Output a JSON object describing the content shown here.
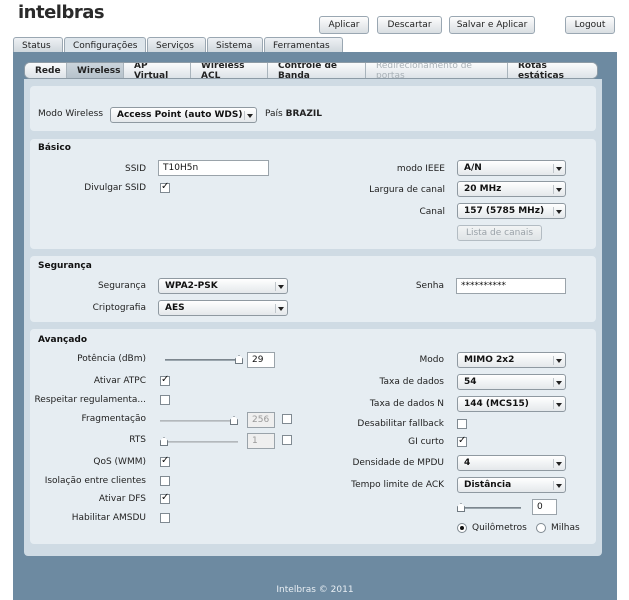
{
  "brand": "intelbras",
  "top_buttons": {
    "apply": "Aplicar",
    "discard": "Descartar",
    "save_apply": "Salvar e Aplicar",
    "logout": "Logout"
  },
  "tabs": [
    "Status",
    "Configurações",
    "Serviços",
    "Sistema",
    "Ferramentas"
  ],
  "subtabs": [
    "Rede",
    "Wireless",
    "AP Virtual",
    "Wireless ACL",
    "Controle de Banda",
    "Redirecionamento de portas",
    "Rotas estáticas"
  ],
  "mode": {
    "label": "Modo Wireless",
    "value": "Access Point (auto WDS)",
    "country_label": "País",
    "country": "BRAZIL"
  },
  "basic": {
    "title": "Básico",
    "ssid_label": "SSID",
    "ssid_value": "T10H5n",
    "broadcast_label": "Divulgar SSID",
    "ieee_label": "modo IEEE",
    "ieee_value": "A/N",
    "width_label": "Largura de canal",
    "width_value": "20 MHz",
    "channel_label": "Canal",
    "channel_value": "157 (5785 MHz)",
    "channel_list_button": "Lista de canais"
  },
  "security": {
    "title": "Segurança",
    "security_label": "Segurança",
    "security_value": "WPA2-PSK",
    "crypto_label": "Criptografia",
    "crypto_value": "AES",
    "password_label": "Senha",
    "password_value": "**********"
  },
  "advanced": {
    "title": "Avançado",
    "power_label": "Potência (dBm)",
    "power_value": "29",
    "power_level": 1.0,
    "atpc_label": "Ativar ATPC",
    "regulation_label": "Respeitar regulamenta...",
    "frag_label": "Fragmentação",
    "frag_value": "256",
    "frag_level": 1.0,
    "rts_label": "RTS",
    "rts_value": "1",
    "rts_level": 0.0,
    "qos_label": "QoS (WMM)",
    "isolation_label": "Isolação entre clientes",
    "dfs_label": "Ativar DFS",
    "amsdu_label": "Habilitar AMSDU",
    "mode_label": "Modo",
    "mode_value": "MIMO 2x2",
    "rate_label": "Taxa de dados",
    "rate_value": "54",
    "rate_n_label": "Taxa de dados N",
    "rate_n_value": "144 (MCS15)",
    "fallback_label": "Desabilitar fallback",
    "gi_label": "GI curto",
    "mpdu_label": "Densidade de MPDU",
    "mpdu_value": "4",
    "ack_label": "Tempo limite de ACK",
    "ack_value": "Distância",
    "distance_value": "0",
    "distance_level": 0.0,
    "km_label": "Quilômetros",
    "miles_label": "Milhas"
  },
  "footer": "Intelbras © 2011"
}
